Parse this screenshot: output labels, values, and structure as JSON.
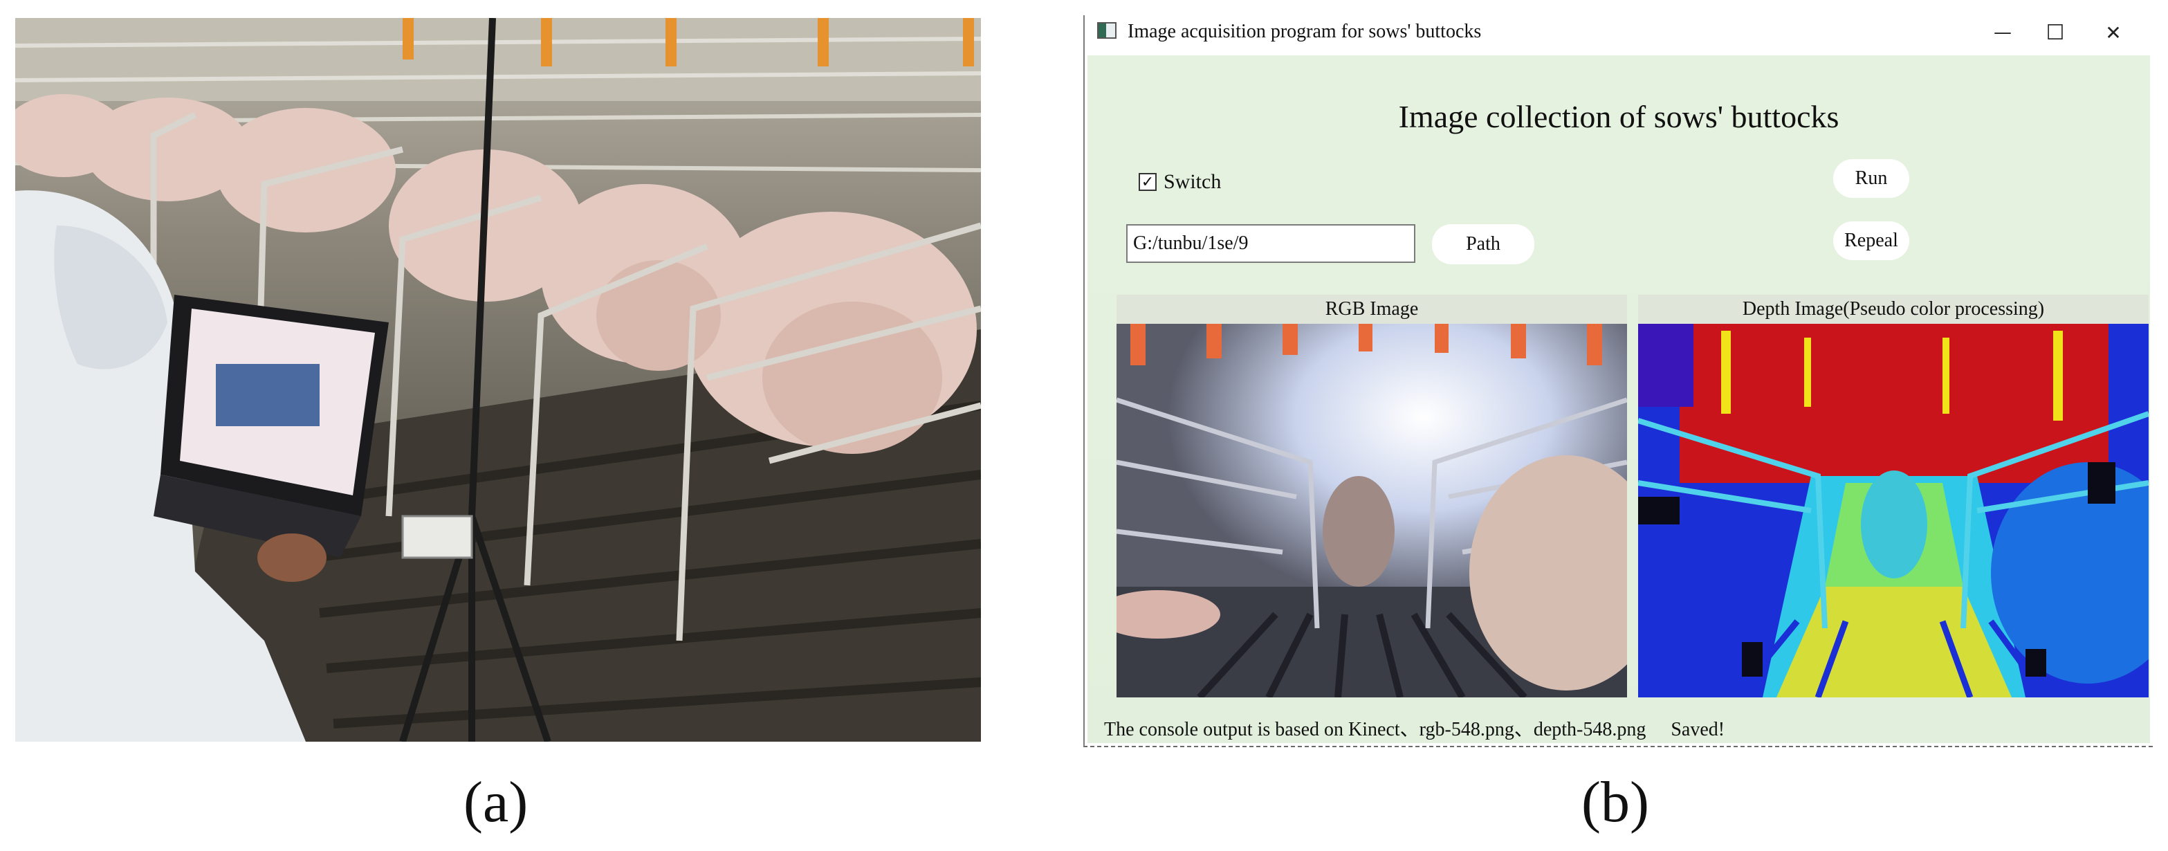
{
  "panels": {
    "a_label": "(a)",
    "b_label": "(b)"
  },
  "window": {
    "title": "Image acquisition program for sows' buttocks",
    "controls": {
      "minimize": "—",
      "maximize": "☐",
      "close": "✕"
    },
    "heading": "Image collection of sows' buttocks",
    "switch": {
      "label": "Switch",
      "checked": true,
      "mark": "✓"
    },
    "run_button": "Run",
    "repeal_button": "Repeal",
    "path_button": "Path",
    "path_value": "G:/tunbu/1se/9",
    "rgb_caption": "RGB Image",
    "depth_caption": "Depth Image(Pseudo color processing)",
    "status": {
      "text": "The console output is based on Kinect、rgb-548.png、depth-548.png",
      "saved": "Saved!"
    }
  },
  "icons": [
    "app-icon",
    "minimize-icon",
    "maximize-icon",
    "close-icon",
    "checkbox-check-icon"
  ],
  "colors": {
    "client_bg": "#e4f1de",
    "button_bg": "#ffffff",
    "depth_red": "#c8141a",
    "depth_blue": "#1a2fd6",
    "depth_cyan": "#2fc8e8",
    "depth_yellow": "#f2e21a"
  }
}
